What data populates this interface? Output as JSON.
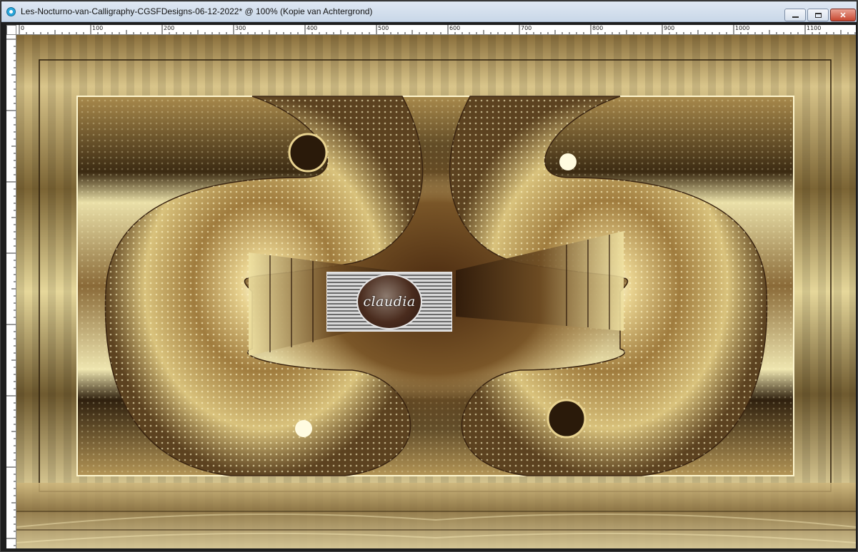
{
  "window": {
    "title": "Les-Nocturno-van-Calligraphy-CGSFDesigns-06-12-2022* @ 100% (Kopie van Achtergrond)",
    "app_icon": "psp-eye-icon",
    "controls": {
      "minimize_icon": "minimize-icon",
      "maximize_icon": "maximize-icon",
      "close_icon": "close-icon",
      "close_glyph": "✕"
    }
  },
  "ruler": {
    "horizontal_labels": [
      "0",
      "100",
      "200",
      "300",
      "400",
      "500",
      "600",
      "700",
      "800",
      "900",
      "1000",
      "1100"
    ],
    "units": "px"
  },
  "canvas": {
    "zoom": "100%",
    "layer": "Kopie van Achtergrond",
    "watermark_text": "claudia",
    "colors": {
      "gold_light": "#f3e7b0",
      "gold_mid": "#b08a4a",
      "gold_dark": "#5a3f1c",
      "brown_deep": "#3a2410"
    }
  }
}
